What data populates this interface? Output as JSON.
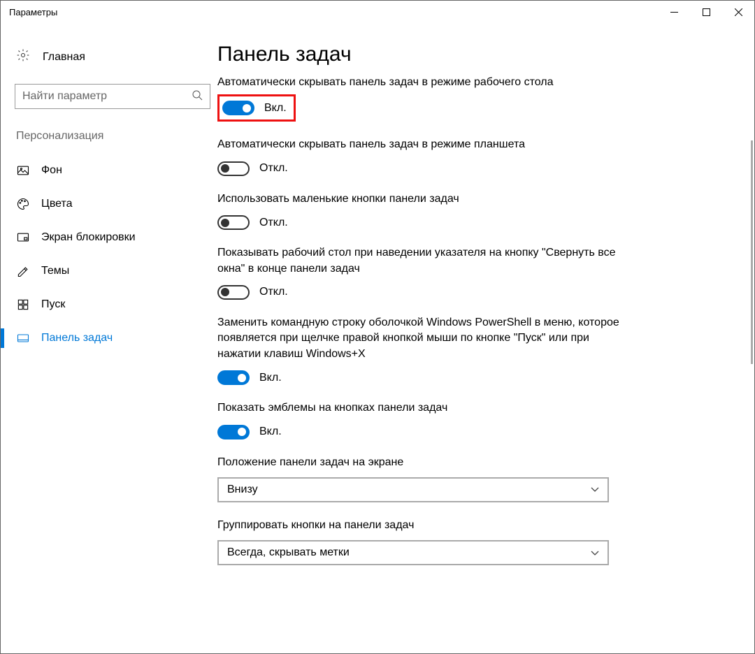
{
  "window": {
    "title": "Параметры"
  },
  "sidebar": {
    "home": "Главная",
    "search_placeholder": "Найти параметр",
    "category": "Персонализация",
    "items": [
      {
        "label": "Фон"
      },
      {
        "label": "Цвета"
      },
      {
        "label": "Экран блокировки"
      },
      {
        "label": "Темы"
      },
      {
        "label": "Пуск"
      },
      {
        "label": "Панель задач"
      }
    ]
  },
  "main": {
    "title": "Панель задач",
    "toggle_on": "Вкл.",
    "toggle_off": "Откл.",
    "settings": [
      {
        "label": "Автоматически скрывать панель задач в режиме рабочего стола"
      },
      {
        "label": "Автоматически скрывать панель задач в режиме планшета"
      },
      {
        "label": "Использовать маленькие кнопки панели задач"
      },
      {
        "label": "Показывать рабочий стол при наведении указателя на кнопку \"Свернуть все окна\" в конце панели задач"
      },
      {
        "label": "Заменить командную строку оболочкой Windows PowerShell в меню, которое появляется при щелчке правой кнопкой мыши по кнопке \"Пуск\" или при нажатии клавиш Windows+X"
      },
      {
        "label": "Показать эмблемы на кнопках панели задач"
      }
    ],
    "dropdown1": {
      "label": "Положение панели задач на экране",
      "value": "Внизу"
    },
    "dropdown2": {
      "label": "Группировать кнопки на панели задач",
      "value": "Всегда, скрывать метки"
    }
  }
}
